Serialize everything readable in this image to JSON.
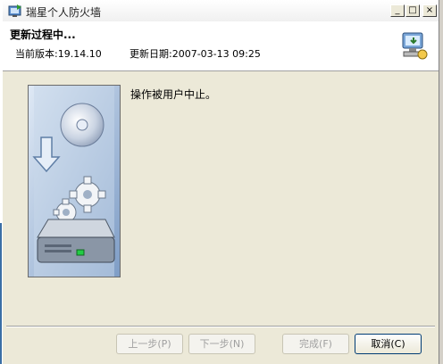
{
  "window": {
    "title": "瑞星个人防火墙",
    "controls": {
      "minimize": "_",
      "maximize": "□",
      "close": "×"
    }
  },
  "header": {
    "title": "更新过程中...",
    "version_text": "当前版本:19.14.10",
    "date_text": "更新日期:2007-03-13 09:25"
  },
  "content": {
    "status_message": "操作被用户中止。"
  },
  "buttons": {
    "prev": "上一步(P)",
    "next": "下一步(N)",
    "finish": "完成(F)",
    "cancel": "取消(C)"
  },
  "colors": {
    "dialog_bg": "#ece9d8",
    "accent_border": "#003c74",
    "disabled_text": "#a0a0a0"
  }
}
